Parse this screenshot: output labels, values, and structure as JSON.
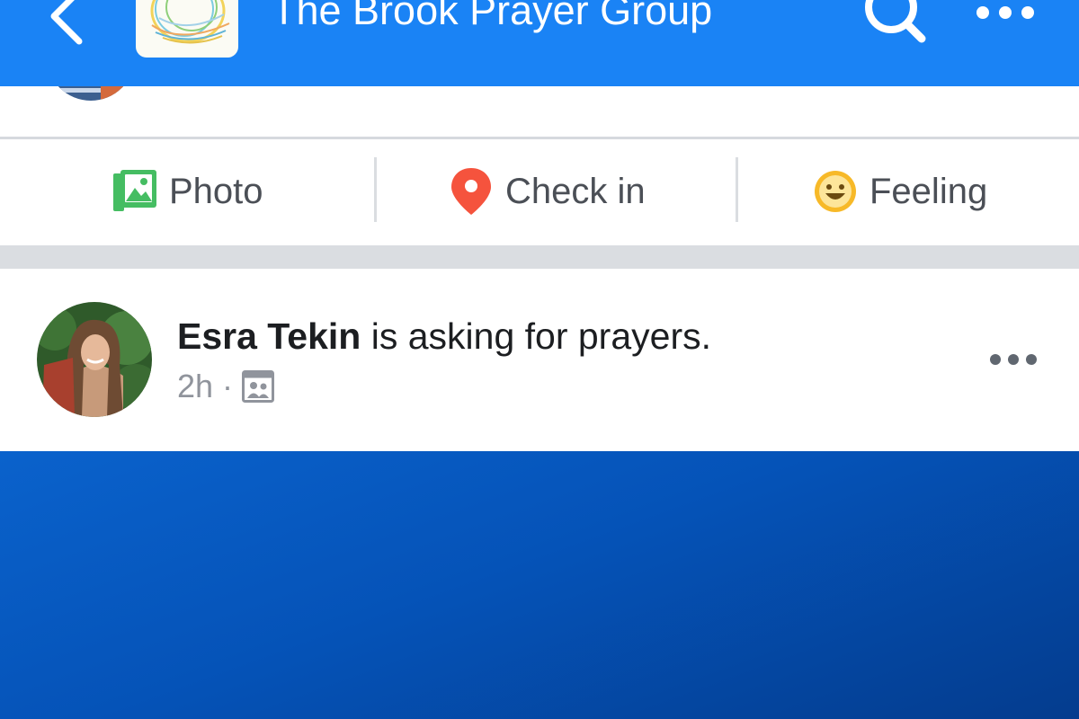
{
  "header": {
    "title": "The Brook Prayer Group",
    "background_color": "#1a83f5",
    "back_icon": "chevron-left-icon",
    "search_icon": "search-icon",
    "more_icon": "more-horizontal-icon"
  },
  "actions": [
    {
      "label": "Photo",
      "icon": "photo-icon",
      "color": "#45bd62"
    },
    {
      "label": "Check in",
      "icon": "location-pin-icon",
      "color": "#f5533d"
    },
    {
      "label": "Feeling",
      "icon": "smiley-icon",
      "color": "#f7b928"
    }
  ],
  "post": {
    "author": "Esra Tekin",
    "action_text": " is asking for prayers.",
    "time": "2h",
    "separator": "·",
    "audience_icon": "group-audience-icon",
    "background_color": "#0553b8"
  }
}
